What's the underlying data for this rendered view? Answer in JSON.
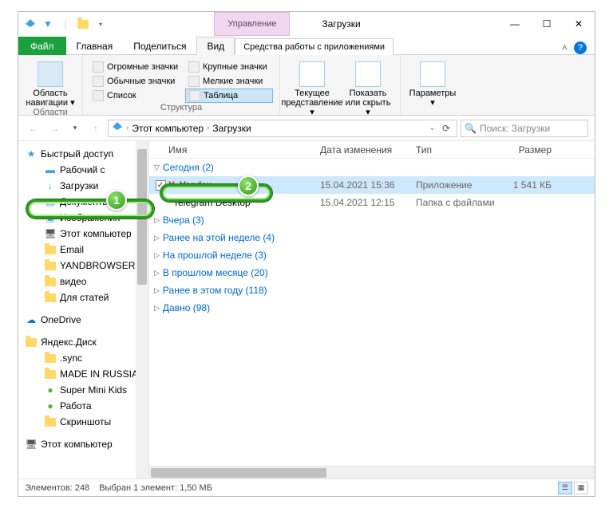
{
  "title": {
    "contextual": "Управление",
    "text": "Загрузки"
  },
  "window_controls": {
    "min": "—",
    "max": "☐",
    "close": "✕"
  },
  "tabs": {
    "file": "Файл",
    "home": "Главная",
    "share": "Поделиться",
    "view": "Вид",
    "contextual": "Средства работы с приложениями",
    "caret": "˄"
  },
  "ribbon": {
    "g1": {
      "label": "Области",
      "btn": "Область навигации ▾"
    },
    "g2": {
      "label": "Структура",
      "huge": "Огромные значки",
      "large": "Крупные значки",
      "normal": "Обычные значки",
      "small": "Мелкие значки",
      "list": "Список",
      "table": "Таблица"
    },
    "g3": {
      "btn1": "Текущее представление ▾",
      "btn2": "Показать или скрыть ▾"
    },
    "g4": {
      "btn": "Параметры ▾"
    }
  },
  "addr": {
    "pc": "Этот компьютер",
    "cur": "Загрузки",
    "search_placeholder": "Поиск: Загрузки"
  },
  "tree": {
    "quick": "Быстрый доступ",
    "desktop": "Рабочий с",
    "downloads": "Загрузки",
    "documents": "Документы",
    "pictures": "Изображения",
    "thispc": "Этот компьютер",
    "email": "Email",
    "yandbrowser": "YANDBROWSER",
    "video": "видео",
    "articles": "Для статей",
    "onedrive": "OneDrive",
    "yadisk": "Яндекс.Диск",
    "sync": ".sync",
    "mir": "MADE IN RUSSIA",
    "smk": "Super Mini Kids",
    "work": "Работа",
    "screenshots": "Скриншоты",
    "thispc2": "Этот компьютер"
  },
  "cols": {
    "name": "Имя",
    "date": "Дата изменения",
    "type": "Тип",
    "size": "Размер"
  },
  "groups": {
    "today": "Сегодня (2)",
    "yesterday": "Вчера (3)",
    "thisweek": "Ранее на этой неделе (4)",
    "lastweek": "На прошлой неделе (3)",
    "lastmonth": "В прошлом месяце (20)",
    "thisyear": "Ранее в этом году (118)",
    "ago": "Давно (98)"
  },
  "files": {
    "yandex": {
      "name": "Yandex",
      "date": "15.04.2021 15:36",
      "type": "Приложение",
      "size": "1 541 КБ"
    },
    "telegram": {
      "name": "Telegram Desktop",
      "date": "15.04.2021 12:15",
      "type": "Папка с файлами",
      "size": ""
    }
  },
  "status": {
    "count": "Элементов: 248",
    "selected": "Выбран 1 элемент: 1,50 МБ"
  },
  "badges": {
    "one": "1",
    "two": "2"
  }
}
